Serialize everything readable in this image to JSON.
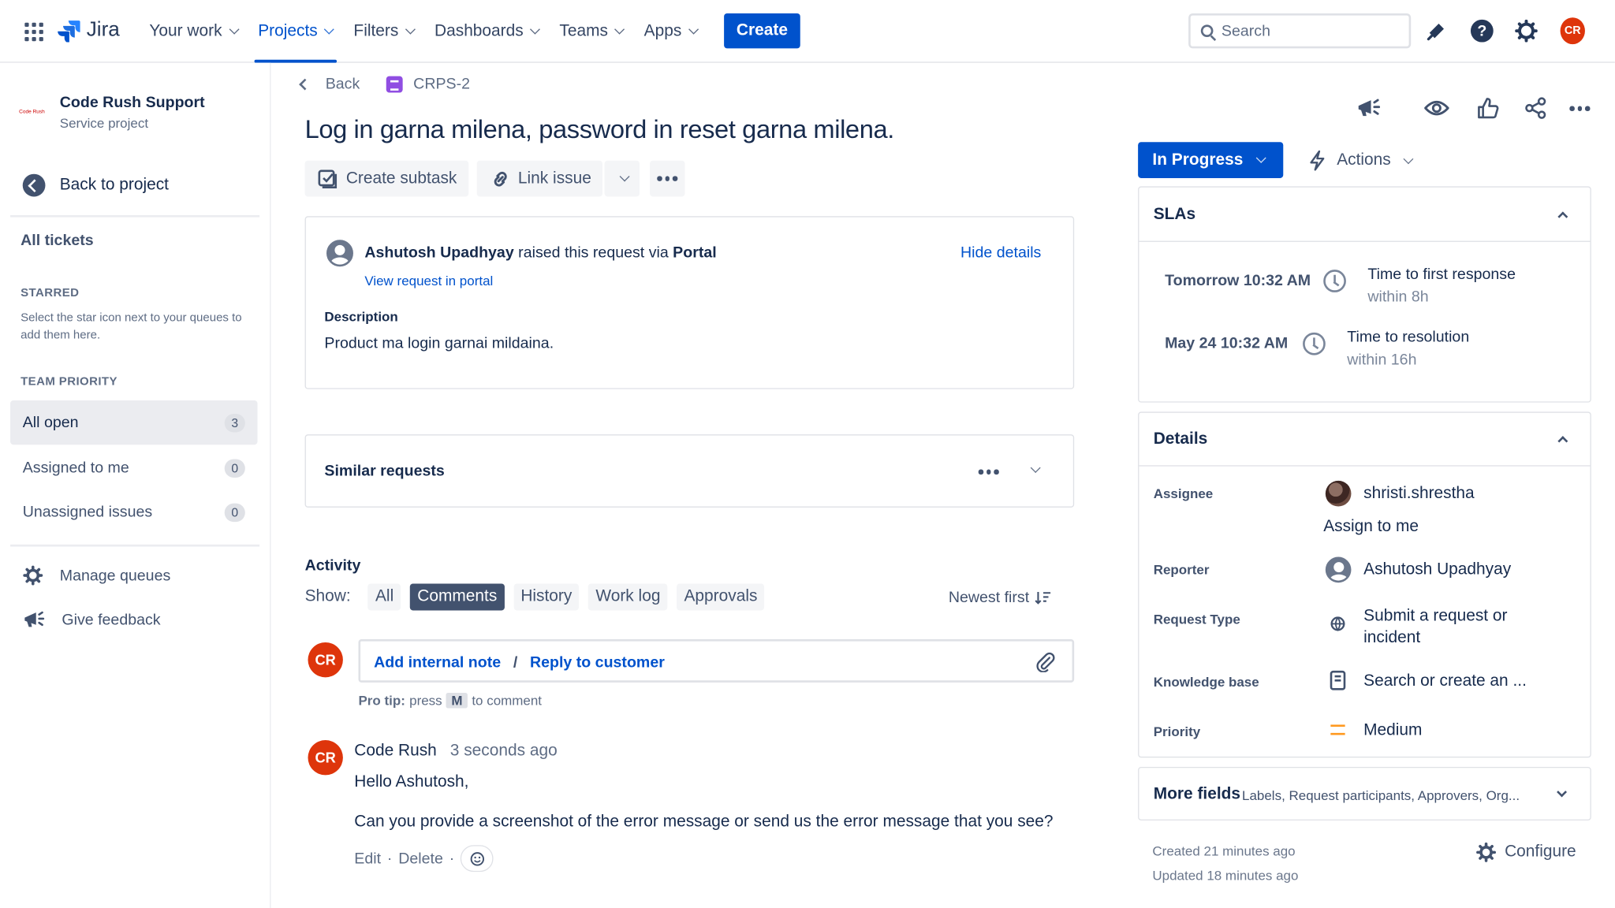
{
  "topnav": {
    "app_name": "Jira",
    "menu": [
      {
        "label": "Your work"
      },
      {
        "label": "Projects"
      },
      {
        "label": "Filters"
      },
      {
        "label": "Dashboards"
      },
      {
        "label": "Teams"
      },
      {
        "label": "Apps"
      }
    ],
    "create_label": "Create",
    "search_placeholder": "Search",
    "avatar_initials": "CR"
  },
  "sidebar": {
    "project_name": "Code Rush Support",
    "project_type": "Service project",
    "project_logo_text": "Code Rush",
    "back_label": "Back to project",
    "all_tickets": "All tickets",
    "starred_caption": "STARRED",
    "starred_note": "Select the star icon next to your queues to add them here.",
    "team_priority_caption": "TEAM PRIORITY",
    "queues": [
      {
        "label": "All open",
        "count": "3"
      },
      {
        "label": "Assigned to me",
        "count": "0"
      },
      {
        "label": "Unassigned issues",
        "count": "0"
      }
    ],
    "manage_queues": "Manage queues",
    "give_feedback": "Give feedback"
  },
  "issue": {
    "back": "Back",
    "key": "CRPS-2",
    "title": "Log in garna milena, password in reset garna milena.",
    "create_subtask": "Create subtask",
    "link_issue": "Link issue",
    "request": {
      "raiser": "Ashutosh Upadhyay",
      "raised_text": "raised this request via",
      "channel": "Portal",
      "hide_details": "Hide details",
      "view_in_portal": "View request in portal",
      "description_label": "Description",
      "description": "Product ma login garnai mildaina."
    },
    "similar_requests": "Similar requests",
    "activity": {
      "heading": "Activity",
      "show_label": "Show:",
      "filters": [
        "All",
        "Comments",
        "History",
        "Work log",
        "Approvals"
      ],
      "sort": "Newest first",
      "add_internal_note": "Add internal note",
      "separator": "/",
      "reply_to_customer": "Reply to customer",
      "pro_tip_label": "Pro tip:",
      "pro_tip_press": "press",
      "pro_tip_key": "M",
      "pro_tip_rest": "to comment",
      "comment": {
        "author": "Code Rush",
        "time": "3 seconds ago",
        "initials": "CR",
        "line1": "Hello Ashutosh,",
        "line2": "Can you provide a screenshot of the error message or send us the error message that you see?",
        "edit": "Edit",
        "delete": "Delete",
        "dot": "·"
      }
    }
  },
  "right": {
    "status": "In Progress",
    "actions": "Actions",
    "slas": {
      "title": "SLAs",
      "items": [
        {
          "when": "Tomorrow 10:32 AM",
          "name": "Time to first response",
          "within": "within 8h"
        },
        {
          "when": "May 24 10:32 AM",
          "name": "Time to resolution",
          "within": "within 16h"
        }
      ]
    },
    "details": {
      "title": "Details",
      "assignee_label": "Assignee",
      "assignee": "shristi.shrestha",
      "assign_to_me": "Assign to me",
      "reporter_label": "Reporter",
      "reporter": "Ashutosh Upadhyay",
      "request_type_label": "Request Type",
      "request_type_1": "Submit a request or",
      "request_type_2": "incident",
      "kb_label": "Knowledge base",
      "kb_value": "Search or create an ...",
      "priority_label": "Priority",
      "priority": "Medium",
      "priority_color": "#ff991f"
    },
    "more_fields": "More fields",
    "more_fields_sub": "Labels, Request participants, Approvers, Org...",
    "created": "Created 21 minutes ago",
    "updated": "Updated 18 minutes ago",
    "configure": "Configure"
  }
}
